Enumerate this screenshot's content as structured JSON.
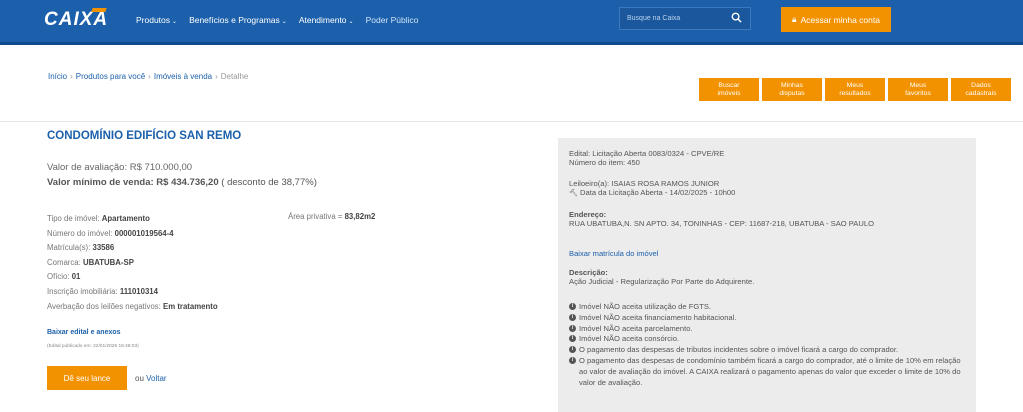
{
  "header": {
    "logo": "CAIXA",
    "nav": [
      {
        "label": "Produtos",
        "dropdown": true
      },
      {
        "label": "Benefícios e Programas",
        "dropdown": true
      },
      {
        "label": "Atendimento",
        "dropdown": true
      },
      {
        "label": "Poder Público",
        "dropdown": false
      }
    ],
    "search_placeholder": "Busque na Caixa",
    "login_label": "Acessar minha conta"
  },
  "breadcrumb": [
    "Início",
    "Produtos para você",
    "Imóveis à venda",
    "Detalhe"
  ],
  "quick_actions": [
    {
      "line1": "Buscar",
      "line2": "imóveis"
    },
    {
      "line1": "Minhas",
      "line2": "disputas"
    },
    {
      "line1": "Meus",
      "line2": "resultados"
    },
    {
      "line1": "Meus",
      "line2": "favoritos"
    },
    {
      "line1": "Dados",
      "line2": "cadastrais"
    }
  ],
  "property": {
    "title": "CONDOMÍNIO EDIFÍCIO SAN REMO",
    "valor_avaliacao_label": "Valor de avaliação:",
    "valor_avaliacao": "R$ 710.000,00",
    "valor_minimo_label": "Valor mínimo de venda:",
    "valor_minimo": "R$ 434.736,20",
    "desconto": "( desconto de 38,77%)",
    "specs": [
      {
        "label": "Tipo de imóvel:",
        "value": "Apartamento"
      },
      {
        "label": "Número do imóvel:",
        "value": "000001019564-4"
      },
      {
        "label": "Matrícula(s):",
        "value": "33586"
      },
      {
        "label": "Comarca:",
        "value": "UBATUBA-SP"
      },
      {
        "label": "Ofício:",
        "value": "01"
      },
      {
        "label": "Inscrição imobiliária:",
        "value": "111010314"
      },
      {
        "label": "Averbação dos leilões negativos:",
        "value": "Em tratamento"
      }
    ],
    "area_label": "Área privativa =",
    "area_value": "83,82m2",
    "edital_link": "Baixar edital e anexos",
    "edital_date": "(Edital publicado em: 22/01/2025 16:48:03)",
    "bid_label": "Dê seu lance",
    "ou": "ou",
    "voltar": "Voltar"
  },
  "panel": {
    "edital": "Edital: Licitação Aberta 0083/0324 - CPVE/RE",
    "numero_item": "Número do item: 450",
    "leiloeiro": "Leiloeiro(a): ISAIAS ROSA RAMOS JUNIOR",
    "data_licitacao": "Data da Licitação Aberta - 14/02/2025 - 10h00",
    "endereco_label": "Endereço:",
    "endereco": "RUA UBATUBA,N. SN APTO. 34, TONINHAS - CEP: 11687-218, UBATUBA - SAO PAULO",
    "matricula_link": "Baixar matrícula do imóvel",
    "descricao_label": "Descrição:",
    "descricao": "Ação Judicial - Regularização Por Parte do Adquirente.",
    "info": [
      "Imóvel NÃO aceita utilização de FGTS.",
      "Imóvel NÃO aceita financiamento habitacional.",
      "Imóvel NÃO aceita parcelamento.",
      "Imóvel NÃO aceita consórcio.",
      "O pagamento das despesas de tributos incidentes sobre o imóvel ficará a cargo do comprador.",
      "O pagamento das despesas de condomínio também ficará a cargo do comprador, até o limite de 10% em relação ao valor de avaliação do imóvel. A CAIXA realizará o pagamento apenas do valor que exceder o limite de 10% do valor de avaliação."
    ]
  },
  "colors": {
    "primary": "#1c60ab",
    "accent": "#f39200"
  }
}
